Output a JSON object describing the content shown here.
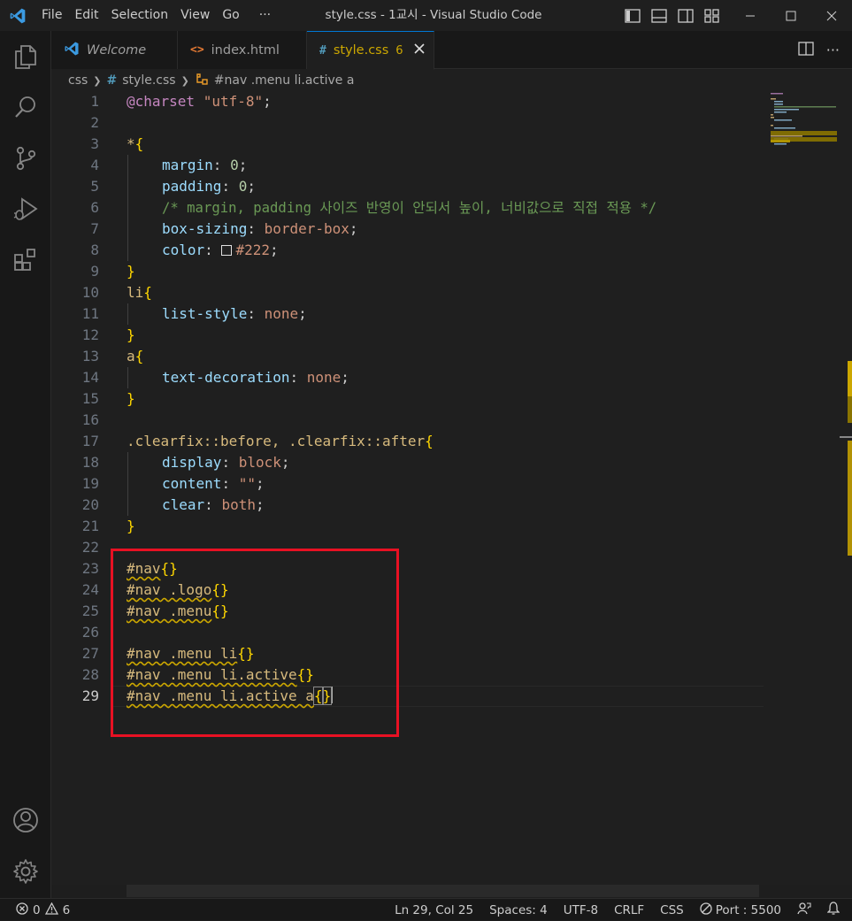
{
  "window": {
    "title": "style.css - 1교시 - Visual Studio Code",
    "menu": [
      "File",
      "Edit",
      "Selection",
      "View",
      "Go",
      "···"
    ]
  },
  "tabs": [
    {
      "label": "Welcome",
      "icon": "vscode-icon",
      "active": false
    },
    {
      "label": "index.html",
      "icon": "html-icon",
      "active": false
    },
    {
      "label": "style.css",
      "icon": "css-hash-icon",
      "active": true,
      "problems": "6"
    }
  ],
  "tab_icon_glyphs": {
    "css": "#",
    "html": "<>"
  },
  "breadcrumb": {
    "folder": "css",
    "file": "style.css",
    "symbol": "#nav .menu li.active a"
  },
  "editor": {
    "line_numbers": [
      "1",
      "2",
      "3",
      "4",
      "5",
      "6",
      "7",
      "8",
      "9",
      "10",
      "11",
      "12",
      "13",
      "14",
      "15",
      "16",
      "17",
      "18",
      "19",
      "20",
      "21",
      "22",
      "23",
      "24",
      "25",
      "26",
      "27",
      "28",
      "29"
    ],
    "current_line": "29",
    "code": {
      "l1_at": "@charset",
      "l1_str": "\"utf-8\"",
      "l1_semi": ";",
      "l3_sel": "*",
      "brace_open": "{",
      "brace_close": "}",
      "l4_prop": "margin",
      "l4_val": "0",
      "l5_prop": "padding",
      "l5_val": "0",
      "l6_comment": "/* margin, padding 사이즈 반영이 안되서 높이, 너비값으로 직접 적용 */",
      "l7_prop": "box-sizing",
      "l7_val": "border-box",
      "l8_prop": "color",
      "l8_val": "#222",
      "l10_sel": "li",
      "l11_prop": "list-style",
      "l11_val": "none",
      "l13_sel": "a",
      "l14_prop": "text-decoration",
      "l14_val": "none",
      "l17_sel": ".clearfix::before, .clearfix::after",
      "l18_prop": "display",
      "l18_val": "block",
      "l19_prop": "content",
      "l19_val": "\"\"",
      "l20_prop": "clear",
      "l20_val": "both",
      "l23_sel": "#nav",
      "l24_sel": "#nav .logo",
      "l25_sel": "#nav .menu",
      "l27_sel": "#nav .menu li",
      "l28_sel": "#nav .menu li.active",
      "l29_sel": "#nav .menu li.active a",
      "colon": ": ",
      "semi": ";"
    }
  },
  "status": {
    "errors": "0",
    "warnings": "6",
    "position": "Ln 29, Col 25",
    "spaces": "Spaces: 4",
    "encoding": "UTF-8",
    "eol": "CRLF",
    "language": "CSS",
    "port": "Port : 5500"
  },
  "colors": {
    "accent": "#0078d4",
    "warning": "#cca700",
    "highlight_box": "#e81123"
  }
}
